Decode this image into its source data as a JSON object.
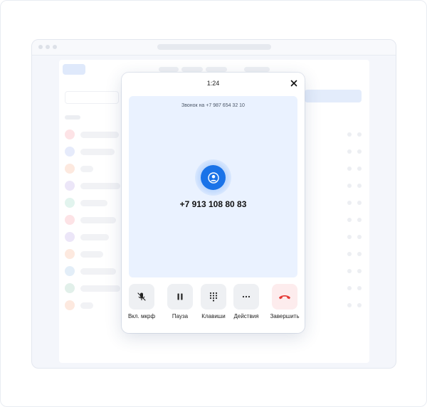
{
  "call": {
    "timer": "1:24",
    "call_label": "Звонок на +7 987 654 32 10",
    "contact_number": "+7 913 108 80 83"
  },
  "controls": [
    {
      "label": "Вкл. мкрф",
      "icon": "mic-off-icon"
    },
    {
      "label": "Пауза",
      "icon": "pause-icon"
    },
    {
      "label": "Клавиши",
      "icon": "keypad-icon"
    },
    {
      "label": "Действия",
      "icon": "more-icon"
    },
    {
      "label": "Завершить",
      "icon": "hangup-icon"
    }
  ],
  "colors": {
    "accent": "#1a73e8",
    "call_area": "#eaf2ff",
    "end_call": "#e53935",
    "avatar_row_colors": [
      "#fde3e6",
      "#e6ebfb",
      "#fde9df",
      "#ece6f8",
      "#e2f4ee",
      "#fde3e6",
      "#ece6f8",
      "#fde9df",
      "#e3eef8",
      "#e2f0ea",
      "#fde9df"
    ]
  }
}
